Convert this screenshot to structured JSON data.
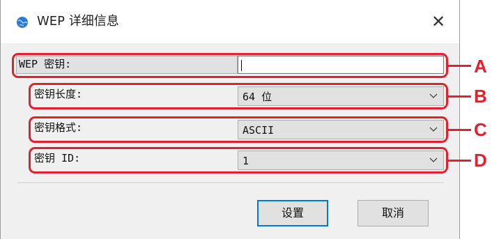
{
  "window": {
    "title": "WEP 详细信息",
    "close_symbol": "✕",
    "icon": "globe-icon"
  },
  "fields": {
    "wep_key": {
      "label": "WEP 密钥:",
      "value": ""
    },
    "key_length": {
      "label": "密钥长度:",
      "value": "64 位"
    },
    "key_format": {
      "label": "密钥格式:",
      "value": "ASCII"
    },
    "key_id": {
      "label": "密钥 ID:",
      "value": "1"
    }
  },
  "callouts": [
    "A",
    "B",
    "C",
    "D"
  ],
  "buttons": {
    "ok": "设置",
    "cancel": "取消"
  },
  "colors": {
    "highlight": "#e3202c",
    "default_button_border": "#0078d7"
  }
}
